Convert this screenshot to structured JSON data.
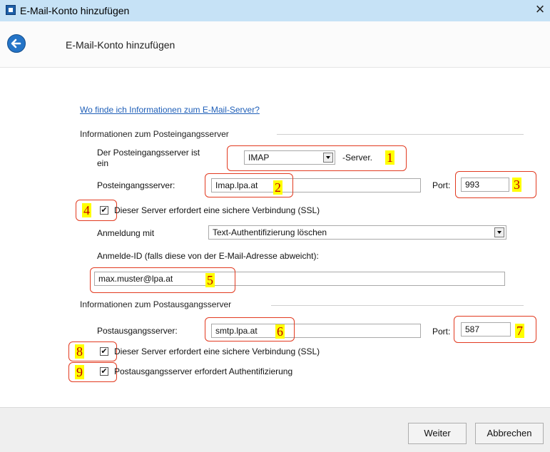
{
  "window": {
    "title": "E-Mail-Konto hinzufügen",
    "close": "×"
  },
  "header": {
    "title": "E-Mail-Konto hinzufügen"
  },
  "help_link": "Wo finde ich Informationen zum E-Mail-Server?",
  "incoming": {
    "section": "Informationen zum Posteingangsserver",
    "type_label_line1": "Der Posteingangsserver ist",
    "type_label_line2": "ein",
    "type_value": "IMAP",
    "type_suffix": "-Server.",
    "server_label": "Posteingangsserver:",
    "server_value": "Imap.lpa.at",
    "port_label": "Port:",
    "port_value": "993",
    "ssl_checked": true,
    "ssl_label": "Dieser Server erfordert eine sichere Verbindung (SSL)",
    "login_label": "Anmeldung mit",
    "login_value": "Text-Authentifizierung löschen",
    "id_label": "Anmelde-ID (falls diese von der E-Mail-Adresse abweicht):",
    "id_value": "max.muster@lpa.at"
  },
  "outgoing": {
    "section": "Informationen zum Postausgangsserver",
    "server_label": "Postausgangsserver:",
    "server_value": "smtp.lpa.at",
    "port_label": "Port:",
    "port_value": "587",
    "ssl_checked": true,
    "ssl_label": "Dieser Server erfordert eine sichere Verbindung (SSL)",
    "auth_checked": true,
    "auth_label": "Postausgangsserver erfordert Authentifizierung"
  },
  "annotations": [
    "1",
    "2",
    "3",
    "4",
    "5",
    "6",
    "7",
    "8",
    "9"
  ],
  "footer": {
    "next": "Weiter",
    "cancel": "Abbrechen"
  },
  "colors": {
    "titlebar": "#c6e2f6",
    "link": "#1f5fb8",
    "annotation_border": "#e23a20",
    "annotation_bg": "#ffff00",
    "annotation_text": "#c00000"
  },
  "icons": {
    "check": "✔"
  }
}
